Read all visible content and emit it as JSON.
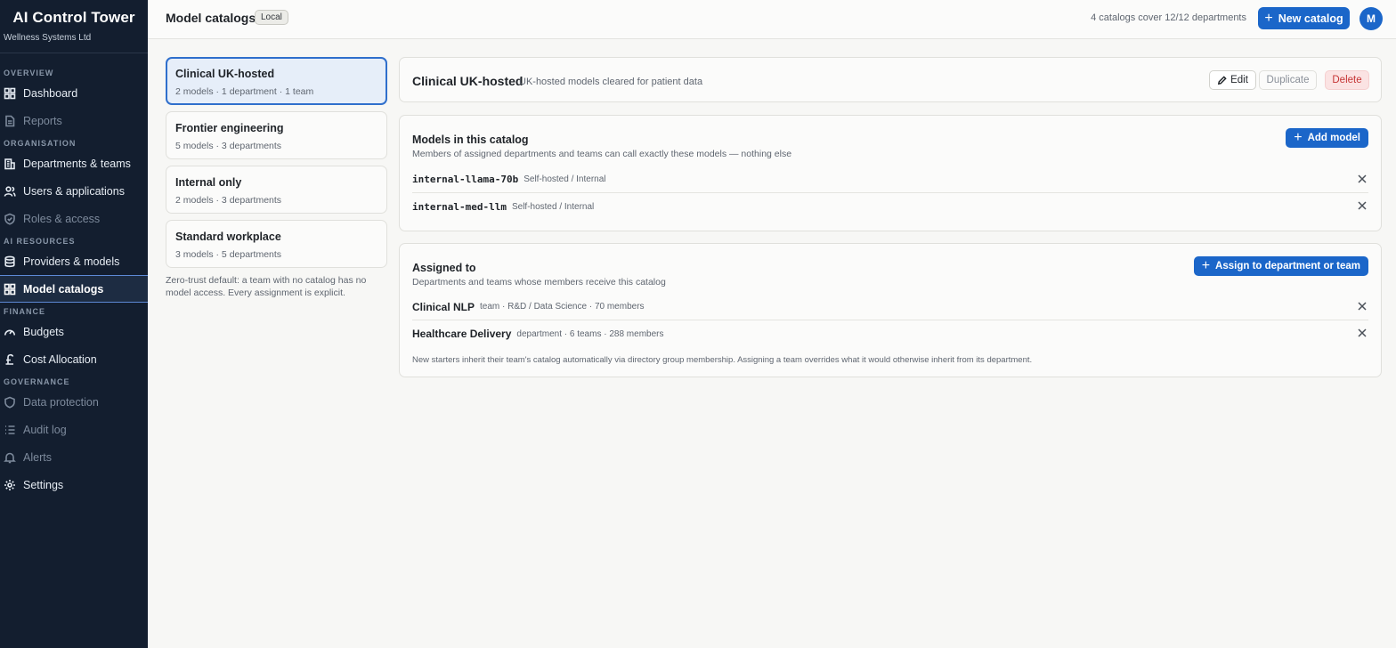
{
  "brand": {
    "title": "AI Control Tower",
    "org": "Wellness Systems Ltd"
  },
  "sidebar": {
    "sections": [
      {
        "label": "OVERVIEW",
        "items": [
          {
            "label": "Dashboard",
            "icon": "grid-icon",
            "muted": false
          },
          {
            "label": "Reports",
            "icon": "document-icon",
            "muted": true
          }
        ]
      },
      {
        "label": "ORGANISATION",
        "items": [
          {
            "label": "Departments & teams",
            "icon": "building-icon",
            "muted": false
          },
          {
            "label": "Users & applications",
            "icon": "users-icon",
            "muted": false
          },
          {
            "label": "Roles & access",
            "icon": "shield-check-icon",
            "muted": true
          }
        ]
      },
      {
        "label": "AI RESOURCES",
        "items": [
          {
            "label": "Providers & models",
            "icon": "database-icon",
            "muted": false
          },
          {
            "label": "Model catalogs",
            "icon": "grid-icon",
            "muted": false,
            "active": true
          }
        ]
      },
      {
        "label": "FINANCE",
        "items": [
          {
            "label": "Budgets",
            "icon": "gauge-icon",
            "muted": false
          },
          {
            "label": "Cost Allocation",
            "icon": "pound-icon",
            "muted": false
          }
        ]
      },
      {
        "label": "GOVERNANCE",
        "items": [
          {
            "label": "Data protection",
            "icon": "shield-icon",
            "muted": true
          },
          {
            "label": "Audit log",
            "icon": "list-icon",
            "muted": true
          },
          {
            "label": "Alerts",
            "icon": "bell-icon",
            "muted": true
          },
          {
            "label": "Settings",
            "icon": "gear-icon",
            "muted": false
          }
        ]
      }
    ]
  },
  "topbar": {
    "title": "Model catalogs",
    "badge": "Local",
    "coverage": "4 catalogs cover 12/12 departments",
    "new_catalog": "New catalog",
    "avatar": "M"
  },
  "catalogs": [
    {
      "name": "Clinical UK-hosted",
      "meta": "2 models · 1 department · 1 team",
      "active": true
    },
    {
      "name": "Frontier engineering",
      "meta": "5 models · 3 departments"
    },
    {
      "name": "Internal only",
      "meta": "2 models · 3 departments"
    },
    {
      "name": "Standard workplace",
      "meta": "3 models · 5 departments"
    }
  ],
  "zero_trust_note": "Zero-trust default: a team with no catalog has no model access. Every assignment is explicit.",
  "detail": {
    "title": "Clinical UK-hosted",
    "subtitle": "UK-hosted models cleared for patient data",
    "edit": "Edit",
    "duplicate": "Duplicate",
    "delete": "Delete"
  },
  "models": {
    "title": "Models in this catalog",
    "subtitle": "Members of assigned departments and teams can call exactly these models — nothing else",
    "add_label": "Add model",
    "rows": [
      {
        "id": "internal-llama-70b",
        "meta": "Self-hosted / Internal"
      },
      {
        "id": "internal-med-llm",
        "meta": "Self-hosted / Internal"
      }
    ]
  },
  "assigned": {
    "title": "Assigned to",
    "subtitle": "Departments and teams whose members receive this catalog",
    "add_label": "Assign to department or team",
    "rows": [
      {
        "name": "Clinical NLP",
        "meta": "team · R&D / Data Science · 70 members"
      },
      {
        "name": "Healthcare Delivery",
        "meta": "department · 6 teams · 288 members"
      }
    ],
    "footnote": "New starters inherit their team's catalog automatically via directory group membership. Assigning a team overrides what it would otherwise inherit from its department."
  }
}
